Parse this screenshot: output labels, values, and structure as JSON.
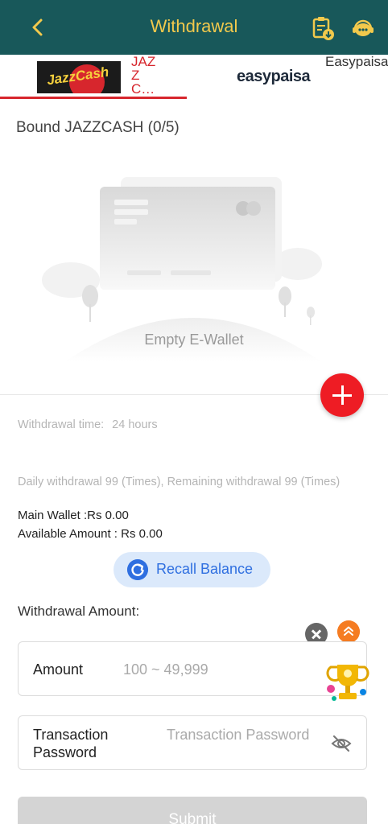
{
  "header": {
    "title": "Withdrawal",
    "back_icon": "chevron-left-icon",
    "record_icon": "clipboard-download-icon",
    "support_icon": "customer-service-icon",
    "colors": {
      "background": "#18585a",
      "accent": "#f2c94c"
    }
  },
  "tabs": [
    {
      "label": "JAZZ C…",
      "logo_text": "JazzCash",
      "active": true
    },
    {
      "label": "Easypaisa",
      "logo_text": "easypaisa",
      "active": false
    }
  ],
  "wallet": {
    "bound_title": "Bound JAZZCASH (0/5)",
    "empty_label": "Empty E-Wallet"
  },
  "info": {
    "withdrawal_time_label": "Withdrawal time:",
    "withdrawal_time_value": "24 hours",
    "daily_limit": "Daily withdrawal 99 (Times), Remaining withdrawal 99 (Times)",
    "main_wallet": "Main Wallet :Rs 0.00",
    "available_amount": "Available Amount : Rs 0.00"
  },
  "recall": {
    "label": "Recall Balance"
  },
  "form": {
    "amount_title": "Withdrawal Amount:",
    "amount_label": "Amount",
    "amount_placeholder": "100 ~ 49,999",
    "password_label": "Transaction Password",
    "password_placeholder": "Transaction Password"
  },
  "submit": {
    "label": "Submit"
  },
  "colors": {
    "primary_red": "#ee1c24",
    "recall_blue": "#2f6fe0",
    "recall_bg": "#dbe9fb",
    "submit_disabled": "#d4d4d4"
  }
}
